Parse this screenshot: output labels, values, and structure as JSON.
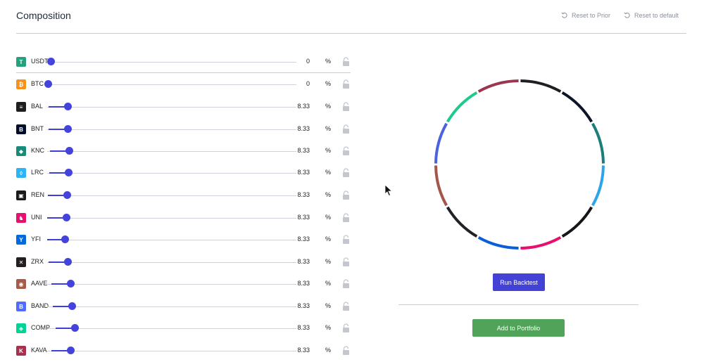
{
  "header": {
    "title": "Composition",
    "reset_prior_label": "Reset to Prior",
    "reset_default_label": "Reset to default"
  },
  "percent_symbol": "%",
  "assets": [
    {
      "symbol": "USDT",
      "value": "0",
      "weight": 0,
      "color": "#26a17b",
      "icon": "tether-icon",
      "glyph": "T",
      "lock_icon": "unlocked-lock-icon"
    },
    {
      "symbol": "BTC",
      "value": "0",
      "weight": 0,
      "color": "#f7931a",
      "icon": "bitcoin-icon",
      "glyph": "₿",
      "lock_icon": "unlocked-lock-icon"
    },
    {
      "symbol": "BAL",
      "value": "8.33",
      "weight": 8.33,
      "color": "#1e1e1e",
      "icon": "balancer-icon",
      "glyph": "≡",
      "lock_icon": "unlocked-lock-icon"
    },
    {
      "symbol": "BNT",
      "value": "8.33",
      "weight": 8.33,
      "color": "#000d2b",
      "icon": "bancor-icon",
      "glyph": "B",
      "lock_icon": "unlocked-lock-icon"
    },
    {
      "symbol": "KNC",
      "value": "8.33",
      "weight": 8.33,
      "color": "#188c79",
      "icon": "kyber-icon",
      "glyph": "◆",
      "lock_icon": "unlocked-lock-icon"
    },
    {
      "symbol": "LRC",
      "value": "8.33",
      "weight": 8.33,
      "color": "#2ab6f6",
      "icon": "loopring-icon",
      "glyph": "◊",
      "lock_icon": "unlocked-lock-icon"
    },
    {
      "symbol": "REN",
      "value": "8.33",
      "weight": 8.33,
      "color": "#1a1a1a",
      "icon": "ren-icon",
      "glyph": "▣",
      "lock_icon": "unlocked-lock-icon"
    },
    {
      "symbol": "UNI",
      "value": "8.33",
      "weight": 8.33,
      "color": "#e8106e",
      "icon": "uniswap-icon",
      "glyph": "♞",
      "lock_icon": "unlocked-lock-icon"
    },
    {
      "symbol": "YFI",
      "value": "8.33",
      "weight": 8.33,
      "color": "#006ae3",
      "icon": "yearn-icon",
      "glyph": "Y",
      "lock_icon": "unlocked-lock-icon"
    },
    {
      "symbol": "ZRX",
      "value": "8.33",
      "weight": 8.33,
      "color": "#231f20",
      "icon": "zerox-icon",
      "glyph": "✕",
      "lock_icon": "unlocked-lock-icon"
    },
    {
      "symbol": "AAVE",
      "value": "8.33",
      "weight": 8.33,
      "color": "#a85a48",
      "icon": "aave-icon",
      "glyph": "◉",
      "lock_icon": "unlocked-lock-icon"
    },
    {
      "symbol": "BAND",
      "value": "8.33",
      "weight": 8.33,
      "color": "#516aff",
      "icon": "band-icon",
      "glyph": "B",
      "lock_icon": "unlocked-lock-icon"
    },
    {
      "symbol": "COMP",
      "value": "8.33",
      "weight": 8.33,
      "color": "#00d395",
      "icon": "compound-icon",
      "glyph": "◈",
      "lock_icon": "unlocked-lock-icon"
    },
    {
      "symbol": "KAVA",
      "value": "8.33",
      "weight": 8.33,
      "color": "#a6304e",
      "icon": "kava-icon",
      "glyph": "K",
      "lock_icon": "unlocked-lock-icon"
    }
  ],
  "donut": {
    "segments": [
      {
        "name": "BAL",
        "value": 8.33,
        "color": "#1e1e24"
      },
      {
        "name": "BNT",
        "value": 8.33,
        "color": "#0c1628"
      },
      {
        "name": "KNC",
        "value": 8.33,
        "color": "#1a7e7a"
      },
      {
        "name": "LRC",
        "value": 8.33,
        "color": "#2ea5e8"
      },
      {
        "name": "REN",
        "value": 8.33,
        "color": "#15151a"
      },
      {
        "name": "UNI",
        "value": 8.33,
        "color": "#e8106e"
      },
      {
        "name": "YFI",
        "value": 8.33,
        "color": "#0a5fd8"
      },
      {
        "name": "ZRX",
        "value": 8.33,
        "color": "#222226"
      },
      {
        "name": "AAVE",
        "value": 8.33,
        "color": "#a2574a"
      },
      {
        "name": "BAND",
        "value": 8.33,
        "color": "#4b63e0"
      },
      {
        "name": "COMP",
        "value": 8.33,
        "color": "#19cc8a"
      },
      {
        "name": "KAVA",
        "value": 8.33,
        "color": "#9c3550"
      }
    ]
  },
  "actions": {
    "run_backtest_label": "Run Backtest",
    "add_to_portfolio_label": "Add to Portfolio"
  }
}
